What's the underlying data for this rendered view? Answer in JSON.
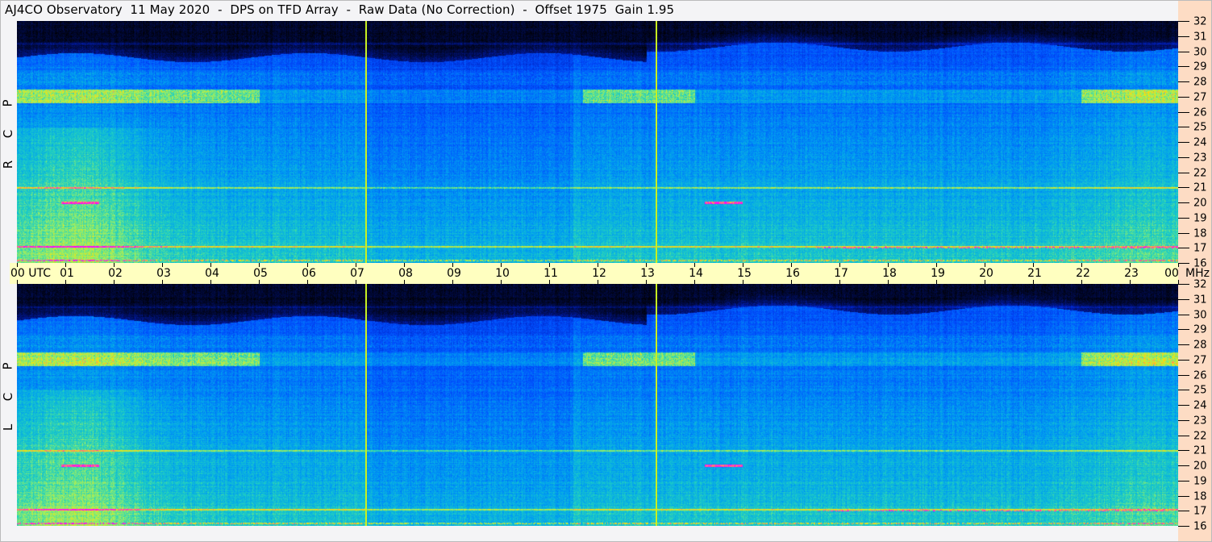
{
  "title": "AJ4CO Observatory  11 May 2020  -  DPS on TFD Array  -  Raw Data (No Correction)  -  Offset 1975  Gain 1.95",
  "chart_data": {
    "type": "heatmap",
    "title": "AJ4CO Observatory  11 May 2020  -  DPS on TFD Array  -  Raw Data (No Correction)  -  Offset 1975  Gain 1.95",
    "x_unit": "UTC",
    "y_unit": "MHz",
    "xlim": [
      0,
      24
    ],
    "ylim": [
      16,
      32
    ],
    "x_tick_labels": [
      "00 UTC",
      "01",
      "02",
      "03",
      "04",
      "05",
      "06",
      "07",
      "08",
      "09",
      "10",
      "11",
      "12",
      "13",
      "14",
      "15",
      "16",
      "17",
      "18",
      "19",
      "20",
      "21",
      "22",
      "23",
      "00"
    ],
    "y_tick_labels": [
      "16",
      "17",
      "18",
      "19",
      "20",
      "21",
      "22",
      "23",
      "24",
      "25",
      "26",
      "27",
      "28",
      "29",
      "30",
      "31",
      "32"
    ],
    "panels": [
      {
        "name": "R C P",
        "letters": [
          "R",
          "C",
          "P"
        ]
      },
      {
        "name": "L C P",
        "letters": [
          "L",
          "C",
          "P"
        ]
      }
    ],
    "vertical_markers_utc": [
      7.2,
      13.2
    ],
    "colormap": [
      "#000000",
      "#000c50",
      "#0020c0",
      "#0050ff",
      "#00a0f0",
      "#20d0c0",
      "#a0f060",
      "#ffe000",
      "#ff00ff"
    ],
    "marker_color": "#c8f020",
    "features": {
      "dark_above_mhz": 30,
      "strong_band_mhz": 27,
      "strong_band_hours": [
        [
          0,
          5
        ],
        [
          11.7,
          14
        ],
        [
          22,
          24
        ]
      ],
      "persistent_lines_mhz": [
        21,
        17.1,
        16.2
      ],
      "intermittent_line_mhz": 20
    },
    "grid": false,
    "legend": "none"
  },
  "axes": {
    "freq_unit_label": "MHz"
  }
}
